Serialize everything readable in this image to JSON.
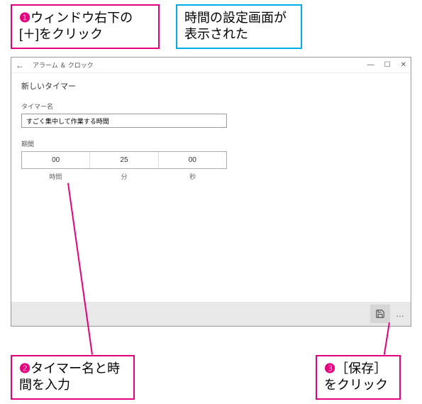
{
  "callouts": {
    "c1": {
      "num": "❶",
      "text": "ウィンドウ右下の[＋]をクリック"
    },
    "blue": {
      "text": "時間の設定画面が表示された"
    },
    "c2": {
      "num": "❷",
      "text": "タイマー名と時間を入力"
    },
    "c3": {
      "num": "❸",
      "text": "［保存］をクリック"
    }
  },
  "window": {
    "title": "アラーム ＆ クロック",
    "heading": "新しいタイマー",
    "timerNameLabel": "タイマー名",
    "timerNameValue": "すごく集中して作業する時間",
    "durationLabel": "期間",
    "duration": {
      "hours": "00",
      "minutes": "25",
      "seconds": "00"
    },
    "durationUnits": {
      "hours": "時間",
      "minutes": "分",
      "seconds": "秒"
    },
    "controls": {
      "minimize": "—",
      "maximize": "☐",
      "close": "✕"
    },
    "more": "…"
  }
}
